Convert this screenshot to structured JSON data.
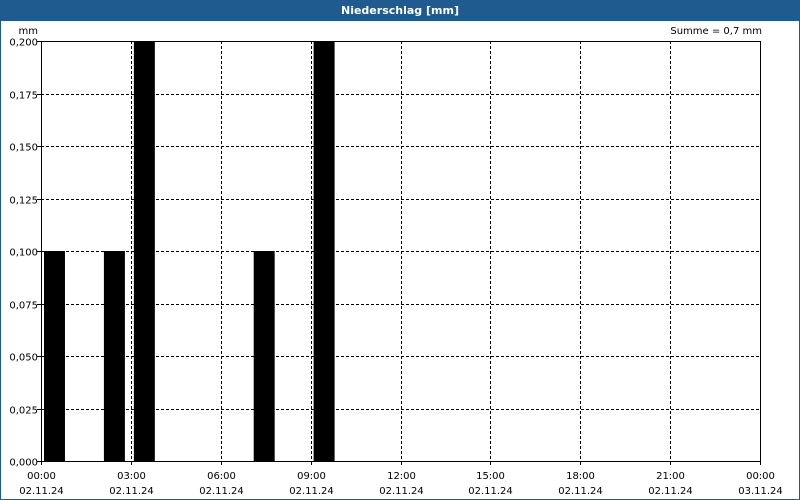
{
  "window": {
    "title": "Niederschlag [mm]"
  },
  "chart_data": {
    "type": "bar",
    "title": "Niederschlag [mm]",
    "annotation": "Summe = 0,7 mm",
    "ylabel": "mm",
    "ylim": [
      0,
      0.2
    ],
    "y_ticks": [
      "0,000",
      "0,025",
      "0,050",
      "0,075",
      "0,100",
      "0,125",
      "0,150",
      "0,175",
      "0,200"
    ],
    "x_ticks": [
      {
        "time": "00:00",
        "date": "02.11.24"
      },
      {
        "time": "03:00",
        "date": "02.11.24"
      },
      {
        "time": "06:00",
        "date": "02.11.24"
      },
      {
        "time": "09:00",
        "date": "02.11.24"
      },
      {
        "time": "12:00",
        "date": "02.11.24"
      },
      {
        "time": "15:00",
        "date": "02.11.24"
      },
      {
        "time": "18:00",
        "date": "02.11.24"
      },
      {
        "time": "21:00",
        "date": "02.11.24"
      },
      {
        "time": "00:00",
        "date": "03.11.24"
      }
    ],
    "x_range": [
      "02.11.24 00:00",
      "03.11.24 00:00"
    ],
    "interval": "hourly",
    "grid": true,
    "series": [
      {
        "color": "#000000",
        "points": [
          {
            "time": "02.11.24 00:00",
            "value": 0.1
          },
          {
            "time": "02.11.24 02:00",
            "value": 0.1
          },
          {
            "time": "02.11.24 03:00",
            "value": 0.2
          },
          {
            "time": "02.11.24 07:00",
            "value": 0.1
          },
          {
            "time": "02.11.24 09:00",
            "value": 0.2
          }
        ]
      }
    ]
  }
}
